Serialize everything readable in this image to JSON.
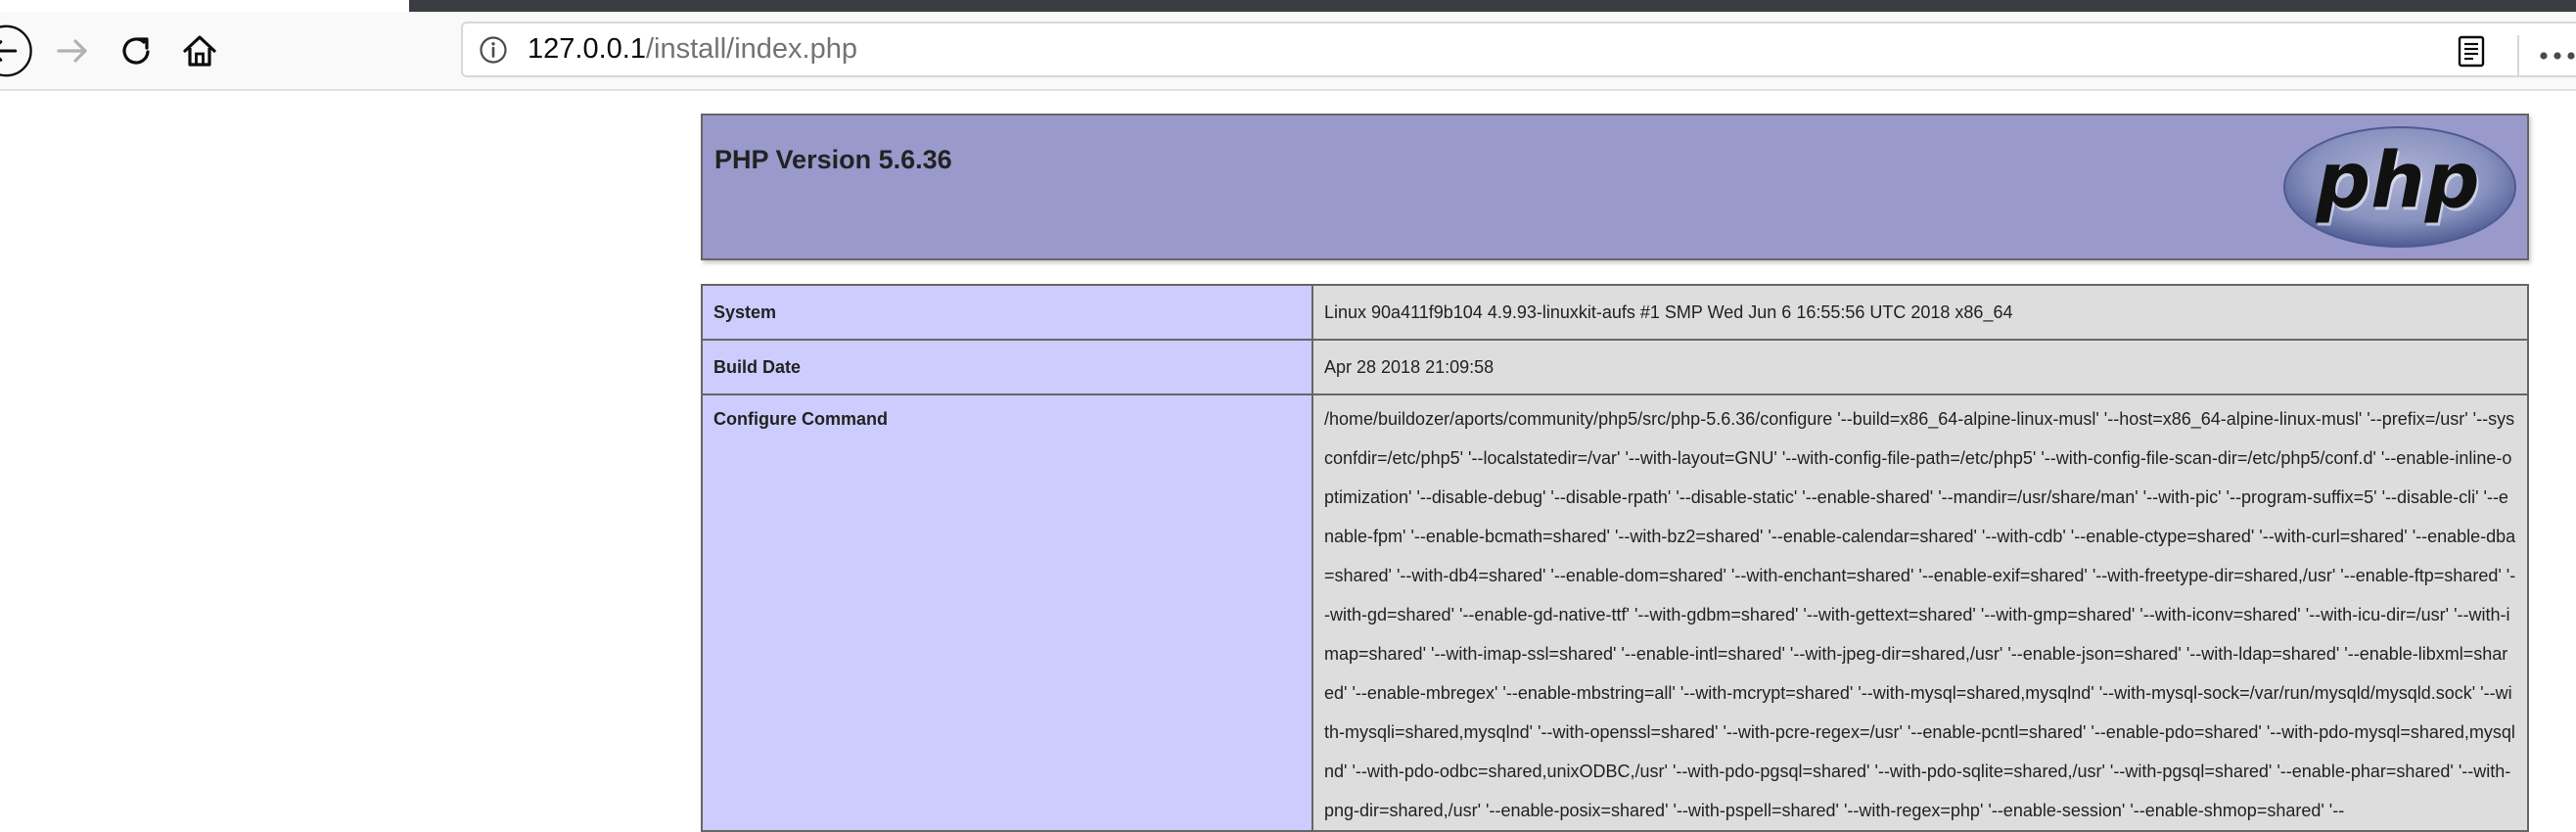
{
  "browser": {
    "url_host": "127.0.0.1",
    "url_path": "/install/index.php"
  },
  "page": {
    "title": "PHP Version 5.6.36",
    "logo_text": "php",
    "rows": {
      "system": {
        "label": "System",
        "value": "Linux 90a411f9b104 4.9.93-linuxkit-aufs #1 SMP Wed Jun 6 16:55:56 UTC 2018 x86_64"
      },
      "build_date": {
        "label": "Build Date",
        "value": "Apr 28 2018 21:09:58"
      },
      "configure_command": {
        "label": "Configure Command",
        "value": "/home/buildozer/aports/community/php5/src/php-5.6.36/configure '--build=x86_64-alpine-linux-musl' '--host=x86_64-alpine-linux-musl' '--prefix=/usr' '--sysconfdir=/etc/php5' '--localstatedir=/var' '--with-layout=GNU' '--with-config-file-path=/etc/php5' '--with-config-file-scan-dir=/etc/php5/conf.d' '--enable-inline-optimization' '--disable-debug' '--disable-rpath' '--disable-static' '--enable-shared' '--mandir=/usr/share/man' '--with-pic' '--program-suffix=5' '--disable-cli' '--enable-fpm' '--enable-bcmath=shared' '--with-bz2=shared' '--enable-calendar=shared' '--with-cdb' '--enable-ctype=shared' '--with-curl=shared' '--enable-dba=shared' '--with-db4=shared' '--enable-dom=shared' '--with-enchant=shared' '--enable-exif=shared' '--with-freetype-dir=shared,/usr' '--enable-ftp=shared' '--with-gd=shared' '--enable-gd-native-ttf' '--with-gdbm=shared' '--with-gettext=shared' '--with-gmp=shared' '--with-iconv=shared' '--with-icu-dir=/usr' '--with-imap=shared' '--with-imap-ssl=shared' '--enable-intl=shared' '--with-jpeg-dir=shared,/usr' '--enable-json=shared' '--with-ldap=shared' '--enable-libxml=shared' '--enable-mbregex' '--enable-mbstring=all' '--with-mcrypt=shared' '--with-mysql=shared,mysqlnd' '--with-mysql-sock=/var/run/mysqld/mysqld.sock' '--with-mysqli=shared,mysqlnd' '--with-openssl=shared' '--with-pcre-regex=/usr' '--enable-pcntl=shared' '--enable-pdo=shared' '--with-pdo-mysql=shared,mysqlnd' '--with-pdo-odbc=shared,unixODBC,/usr' '--with-pdo-pgsql=shared' '--with-pdo-sqlite=shared,/usr' '--with-pgsql=shared' '--enable-phar=shared' '--with-png-dir=shared,/usr' '--enable-posix=shared' '--with-pspell=shared' '--with-regex=php' '--enable-session' '--enable-shmop=shared' '--"
      }
    }
  }
}
